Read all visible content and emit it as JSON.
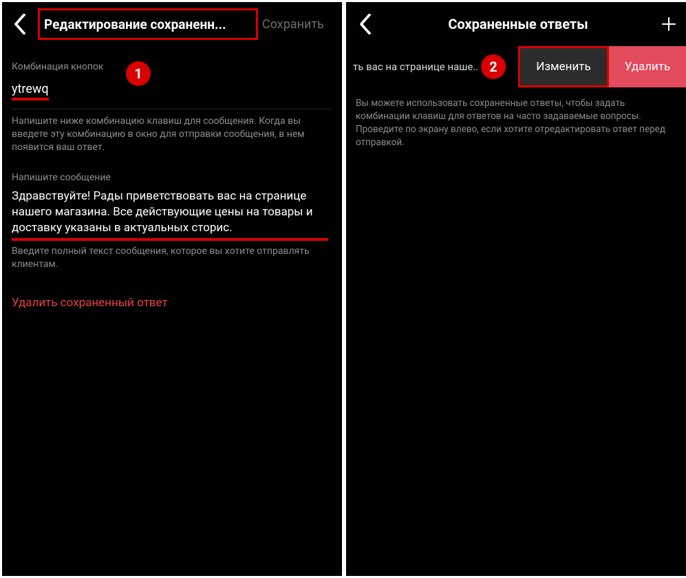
{
  "screen1": {
    "title": "Редактирование сохраненн...",
    "save_label": "Сохранить",
    "shortcut_section_label": "Комбинация кнопок",
    "shortcut_value": "ytrewq",
    "shortcut_hint": "Напишите ниже комбинацию клавиш для сообщения. Когда вы введете эту комбинацию в окно для отправки сообщения, в нем появится ваш ответ.",
    "message_section_label": "Напишите сообщение",
    "message_value": "Здравствуйте! Рады приветствовать вас на странице нашего магазина. Все действующие цены на товары и доставку указаны в актуальных сторис.",
    "message_hint": "Введите полный текст сообщения, которое вы хотите отправлять клиентам.",
    "delete_label": "Удалить сохраненный ответ",
    "badge": "1"
  },
  "screen2": {
    "title": "Сохраненные ответы",
    "list_preview": "ть вас на странице наше..",
    "edit_label": "Изменить",
    "delete_label": "Удалить",
    "info": "Вы можете использовать сохраненные ответы, чтобы задать комбинации клавиш для ответов на часто задаваемые вопросы. Проведите по экрану влево, если хотите отредактировать ответ перед отправкой.",
    "badge": "2"
  }
}
